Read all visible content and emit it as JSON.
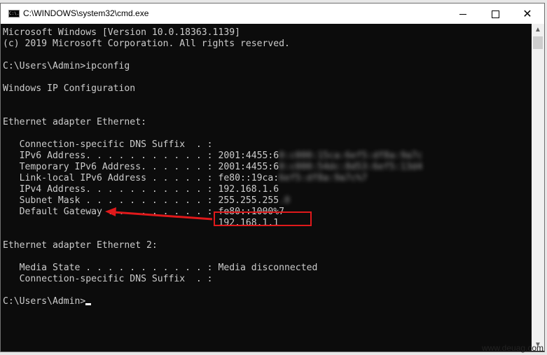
{
  "window": {
    "title": "C:\\WINDOWS\\system32\\cmd.exe",
    "icon": "cmd-icon",
    "icon_text": "C:\\.",
    "controls": {
      "minimize": "minimize-icon",
      "maximize": "maximize-icon",
      "close": "close-icon",
      "close_glyph": "✕"
    }
  },
  "console": {
    "lines": [
      {
        "text": "Microsoft Windows [Version 10.0.18363.1139]"
      },
      {
        "text": "(c) 2019 Microsoft Corporation. All rights reserved."
      },
      {
        "text": ""
      },
      {
        "text": "C:\\Users\\Admin>ipconfig"
      },
      {
        "text": ""
      },
      {
        "text": "Windows IP Configuration"
      },
      {
        "text": ""
      },
      {
        "text": ""
      },
      {
        "text": "Ethernet adapter Ethernet:"
      },
      {
        "text": ""
      },
      {
        "text": "   Connection-specific DNS Suffix  . :"
      },
      {
        "text": "   IPv6 Address. . . . . . . . . . . : 2001:4455:6",
        "blurred": "0:c000:15ca:6ef5:df8a:9a7c"
      },
      {
        "text": "   Temporary IPv6 Address. . . . . . : 2001:4455:6",
        "blurred": "0:c000:54dc:8d53:6ef5:13d4"
      },
      {
        "text": "   Link-local IPv6 Address . . . . . : fe80::19ca:",
        "blurred": "6ef5:df8a:9a7c%7"
      },
      {
        "text": "   IPv4 Address. . . . . . . . . . . : 192.168.1.6"
      },
      {
        "text": "   Subnet Mask . . . . . . . . . . . : 255.255.255",
        "blurred": ".0"
      },
      {
        "text": "   Default Gateway . . . . . . . . . : fe80::1000%7"
      },
      {
        "text": "                                       192.168.1.1"
      },
      {
        "text": ""
      },
      {
        "text": "Ethernet adapter Ethernet 2:"
      },
      {
        "text": ""
      },
      {
        "text": "   Media State . . . . . . . . . . . : Media disconnected"
      },
      {
        "text": "   Connection-specific DNS Suffix  . :"
      },
      {
        "text": ""
      },
      {
        "text": "C:\\Users\\Admin>",
        "cursor": true
      }
    ]
  },
  "annotation": {
    "highlighted_value": "192.168.1.1",
    "target_label": "Default Gateway",
    "color": "#e0191b"
  },
  "scrollbar": {
    "up": "▲",
    "down": "▼"
  },
  "watermark": "www.deuag.com"
}
